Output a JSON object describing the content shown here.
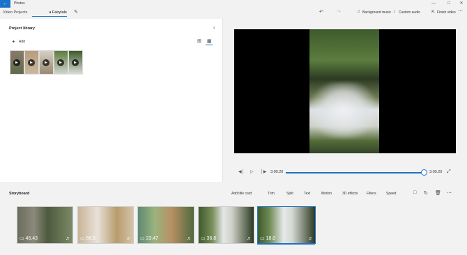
{
  "window": {
    "app_name": "Photos",
    "controls": [
      "—",
      "□",
      "✕"
    ]
  },
  "toolbar": {
    "breadcrumb": "Video Projects",
    "project_name": "a Fairytale",
    "background_music": "Background music",
    "custom_audio": "Custom audio",
    "finish_video": "Finish video"
  },
  "library": {
    "title": "Project library",
    "add_label": "Add",
    "item_count": 5
  },
  "player": {
    "current_time": "3:00.20",
    "end_time": "3:00.20",
    "progress": 0.99
  },
  "storyboard": {
    "title": "Storyboard",
    "tools": [
      "Add title card",
      "Trim",
      "Split",
      "Text",
      "Motion",
      "3D effects",
      "Filters",
      "Speed"
    ],
    "clips": [
      {
        "duration": "45.43"
      },
      {
        "duration": "56.5"
      },
      {
        "duration": "23.47"
      },
      {
        "duration": "36.8"
      },
      {
        "duration": "18.0",
        "selected": true
      }
    ]
  },
  "colors": {
    "accent": "#1a73c8"
  }
}
